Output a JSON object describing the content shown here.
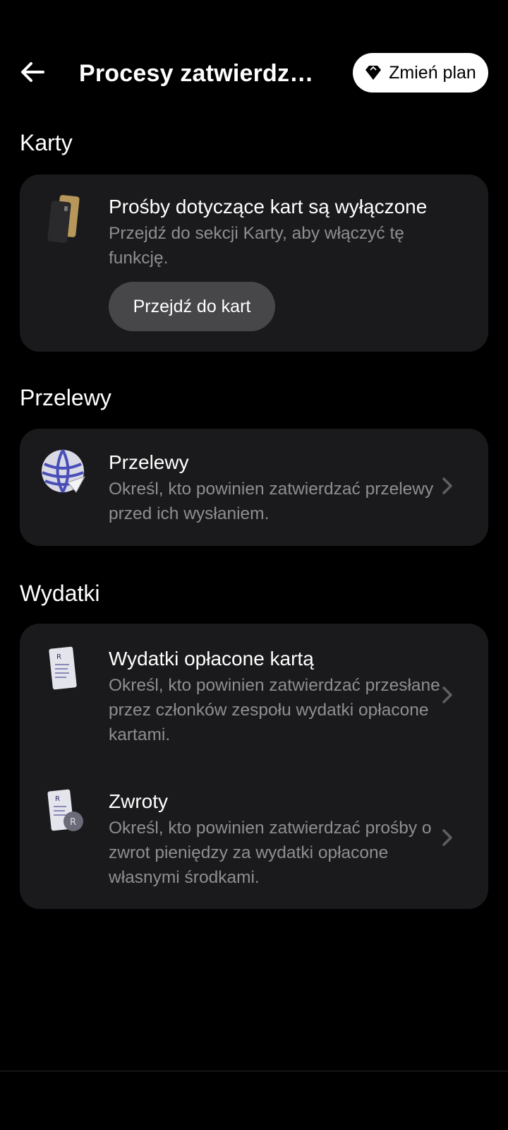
{
  "header": {
    "title": "Procesy zatwierdz…",
    "plan_button": "Zmień plan"
  },
  "sections": {
    "cards": {
      "title": "Karty",
      "item_title": "Prośby dotyczące kart są wyłączone",
      "item_desc": "Przejdź do sekcji Karty, aby włączyć tę funkcję.",
      "button": "Przejdź do kart"
    },
    "transfers": {
      "title": "Przelewy",
      "item_title": "Przelewy",
      "item_desc": "Określ, kto powinien zatwierdzać przelewy przed ich wysłaniem."
    },
    "expenses": {
      "title": "Wydatki",
      "items": [
        {
          "title": "Wydatki opłacone kartą",
          "desc": "Określ, kto powinien zatwierdzać przesłane przez członków zespołu wydatki opłacone kartami."
        },
        {
          "title": "Zwroty",
          "desc": "Określ, kto powinien zatwierdzać prośby o zwrot pieniędzy za wydatki opłacone własnymi środkami."
        }
      ]
    }
  },
  "colors": {
    "background": "#000000",
    "card": "#1a1a1c",
    "secondary_text": "#8e8e93",
    "button_dark": "#47474a",
    "button_light": "#ffffff"
  }
}
